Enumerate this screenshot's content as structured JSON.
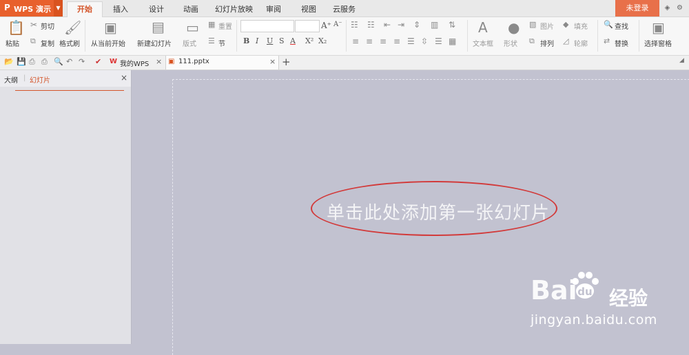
{
  "app": {
    "logo": "P",
    "name": "WPS 演示"
  },
  "ribbon_tabs": [
    "开始",
    "插入",
    "设计",
    "动画",
    "幻灯片放映",
    "审阅",
    "视图",
    "云服务"
  ],
  "login_label": "未登录",
  "ribbon": {
    "paste": "粘贴",
    "cut": "剪切",
    "copy": "复制",
    "format_painter": "格式刷",
    "from_current": "从当前开始",
    "new_slide": "新建幻灯片",
    "layout": "版式",
    "reset": "重置",
    "section": "节",
    "textbox": "文本框",
    "shape": "形状",
    "picture": "图片",
    "fill": "填充",
    "find": "查找",
    "arrange": "排列",
    "outline": "轮廓",
    "replace": "替换",
    "selection_pane": "选择窗格",
    "font_buttons": [
      "B",
      "I",
      "U",
      "S",
      "A",
      "X²",
      "X₂"
    ]
  },
  "doc_tabs": [
    {
      "label": "我的WPS",
      "close": "×"
    },
    {
      "label": "111.pptx",
      "close": "×"
    }
  ],
  "new_tab": "+",
  "panel": {
    "tab_outline": "大纲",
    "tab_slides": "幻灯片",
    "close": "×"
  },
  "slide": {
    "placeholder": "单击此处添加第一张幻灯片"
  },
  "watermark": {
    "logo_text": "Bai",
    "logo_suffix": "经验",
    "url": "jingyan.baidu.com"
  },
  "colors": {
    "accent": "#e8602c",
    "annotation": "#d23a3a",
    "canvas": "#c2c2d0"
  }
}
